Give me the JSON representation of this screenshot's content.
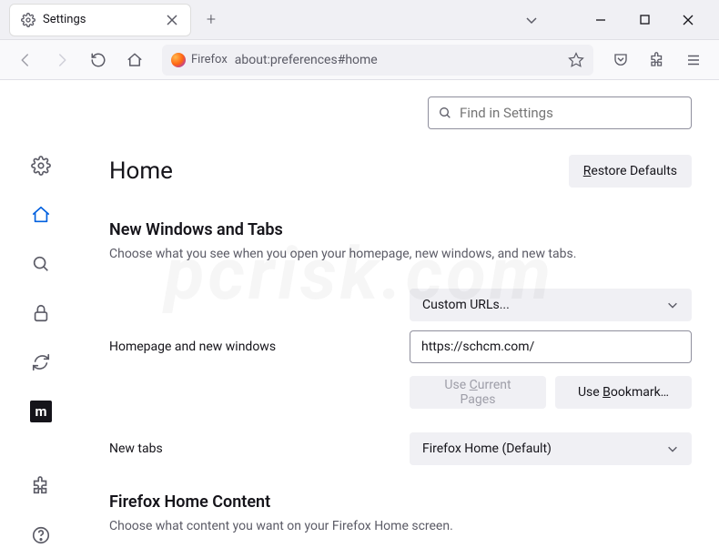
{
  "tab": {
    "title": "Settings"
  },
  "urlbar": {
    "brand": "Firefox",
    "url": "about:preferences#home"
  },
  "search": {
    "placeholder": "Find in Settings"
  },
  "page": {
    "title": "Home",
    "restore": "estore Defaults"
  },
  "section1": {
    "title": "New Windows and Tabs",
    "desc": "Choose what you see when you open your homepage, new windows, and new tabs."
  },
  "homepage": {
    "label": "Homepage and new windows",
    "select": "Custom URLs...",
    "value": "https://schcm.com/",
    "use_current": "urrent Pages",
    "use_current_prefix": "Use ",
    "use_bookmark": "ookmark…",
    "use_bookmark_prefix": "Use "
  },
  "newtabs": {
    "label": "New tabs",
    "select": "Firefox Home (Default)"
  },
  "section2": {
    "title": "Firefox Home Content",
    "desc": "Choose what content you want on your Firefox Home screen."
  },
  "watermark": "pcrisk.com"
}
